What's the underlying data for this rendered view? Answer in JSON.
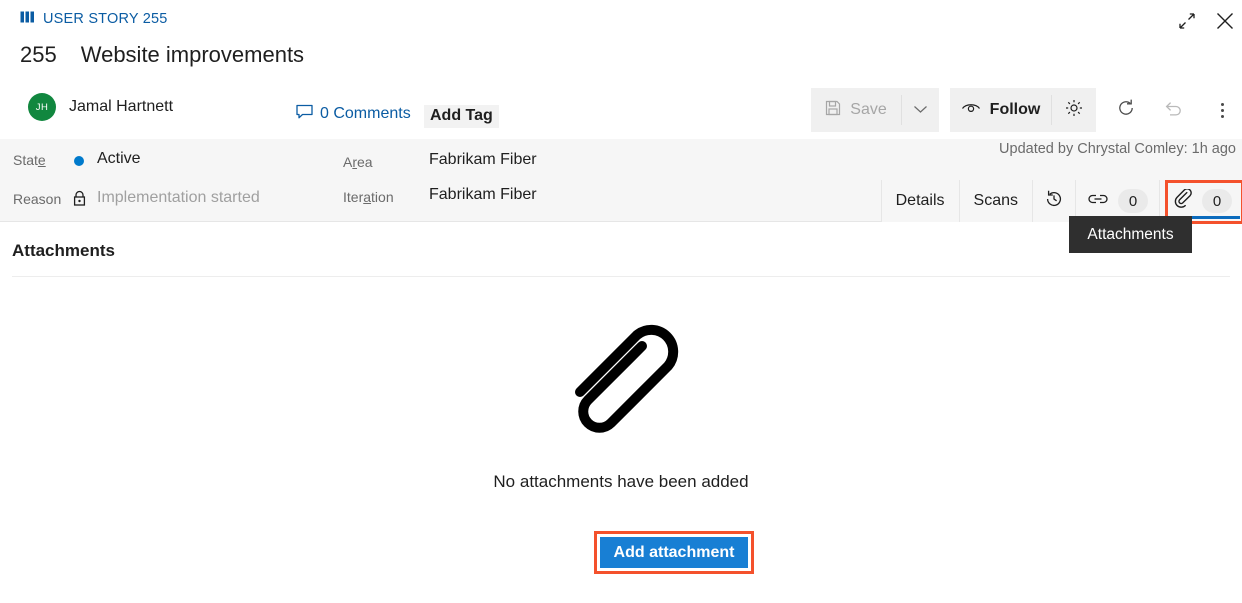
{
  "window": {
    "breadcrumb": "USER STORY 255",
    "breadcrumb_icon": "work-item-icon",
    "restore_icon": "restore-down-icon",
    "close_icon": "close-icon"
  },
  "work_item": {
    "id": "255",
    "title": "Website improvements",
    "assignee": "Jamal Hartnett",
    "assignee_initials": "JH",
    "avatar_color": "#11873f",
    "comments_label": "0 Comments",
    "add_tag_label": "Add Tag",
    "updated_by": "Updated by Chrystal Comley: 1h ago"
  },
  "toolbar": {
    "save_label": "Save",
    "save_icon": "save-disk-icon",
    "save_caret_icon": "chevron-down-icon",
    "follow_label": "Follow",
    "follow_icon": "eye-icon",
    "gear_icon": "gear-icon",
    "refresh_icon": "refresh-icon",
    "undo_icon": "undo-icon",
    "kebab_icon": "more-actions-icon"
  },
  "fields": {
    "state": {
      "label": "State",
      "label_pre": "Stat",
      "label_key": "e",
      "value": "Active",
      "dot_color": "#007acc"
    },
    "reason": {
      "label": "Reason",
      "value": "Implementation started",
      "lock_icon": "lock-icon"
    },
    "area": {
      "label": "Area",
      "label_pre": "A",
      "label_key": "r",
      "label_post": "ea",
      "value": "Fabrikam Fiber"
    },
    "iteration": {
      "label": "Iteration",
      "label_pre": "Iter",
      "label_key": "a",
      "label_post": "tion",
      "value": "Fabrikam Fiber"
    }
  },
  "tabs": [
    {
      "label": "Details",
      "name": "tab-details"
    },
    {
      "label": "Scans",
      "name": "tab-scans"
    },
    {
      "label": "",
      "name": "tab-history",
      "icon": "history-icon"
    },
    {
      "label": "",
      "name": "tab-links",
      "icon": "link-icon",
      "badge": "0"
    },
    {
      "label": "",
      "name": "tab-attachments",
      "icon": "paperclip-icon",
      "badge": "0",
      "selected": true
    }
  ],
  "tooltip": {
    "text": "Attachments"
  },
  "section": {
    "title": "Attachments"
  },
  "empty_state": {
    "icon": "paperclip-large-icon",
    "message": "No attachments have been added",
    "button_label": "Add attachment",
    "button_color": "#187fd4"
  },
  "highlights": {
    "color": "#f4512c"
  }
}
